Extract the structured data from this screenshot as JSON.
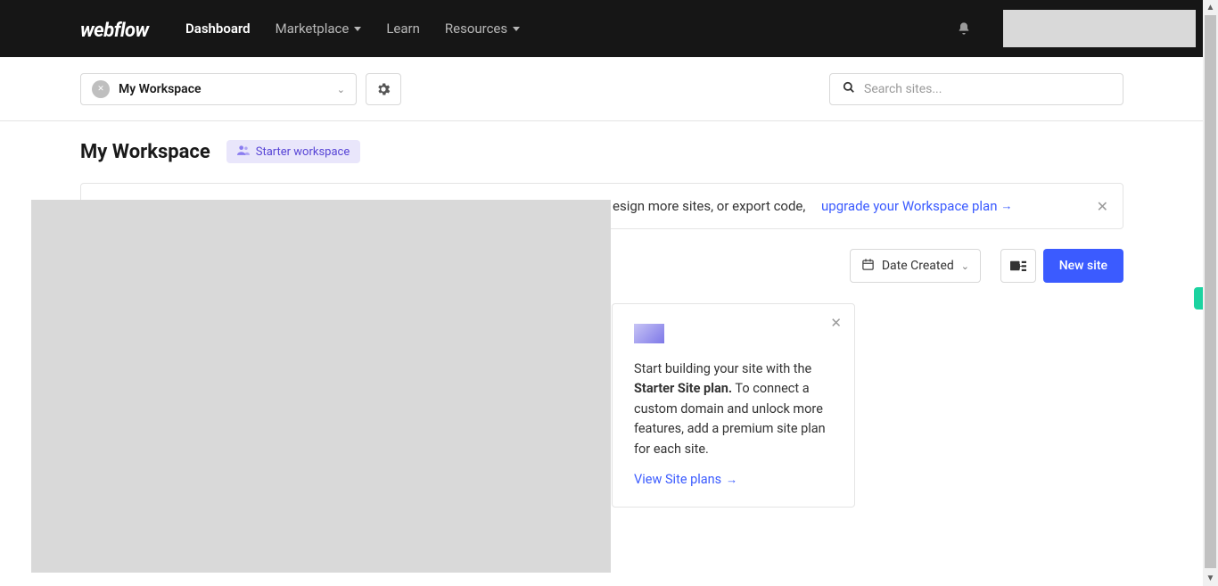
{
  "logo": "webflow",
  "nav": {
    "dashboard": "Dashboard",
    "marketplace": "Marketplace",
    "learn": "Learn",
    "resources": "Resources"
  },
  "workspace_selector": {
    "name": "My Workspace"
  },
  "search": {
    "placeholder": "Search sites..."
  },
  "page_title": "My Workspace",
  "plan_badge": "Starter workspace",
  "banner": {
    "text_tail": "esign more sites, or export code, ",
    "link": "upgrade your Workspace plan"
  },
  "sort": {
    "label": "Date Created"
  },
  "new_site": "New site",
  "card": {
    "line1": "Start building your site with the ",
    "strong": "Starter Site plan.",
    "line2": " To connect a custom domain and unlock more features, add a premium site plan for each site.",
    "link": "View Site plans"
  }
}
